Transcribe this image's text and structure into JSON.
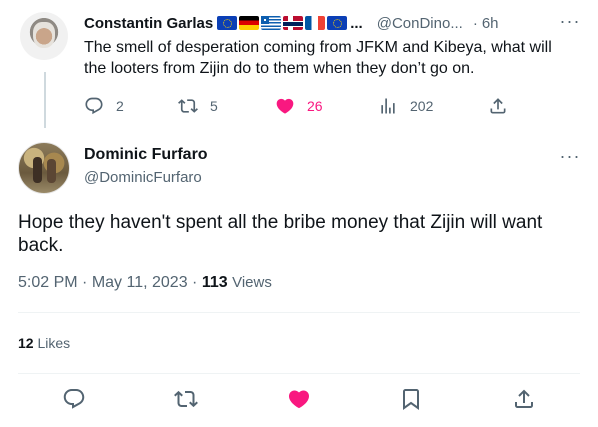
{
  "parent_tweet": {
    "name": "Constantin Garlas",
    "flags_ellipsis": "...",
    "handle": "@ConDino...",
    "time": "6h",
    "more_label": "···",
    "text": "The smell of desperation coming from JFKM and Kibeya, what will the looters from Zijin do to them when they don’t go on.",
    "reply_count": "2",
    "retweet_count": "5",
    "like_count": "26",
    "view_count": "202",
    "like_color": "#f91880"
  },
  "main_tweet": {
    "name": "Dominic Furfaro",
    "handle": "@DominicFurfaro",
    "more_label": "···",
    "text": "Hope they haven't spent all the bribe money that Zijin will want back.",
    "time": "5:02 PM",
    "date": "May 11, 2023",
    "separator": "·",
    "views_count": "113",
    "views_label": "Views",
    "likes_count": "12",
    "likes_label": "Likes",
    "like_color": "#f91880"
  },
  "icons": {
    "reply": "reply-icon",
    "retweet": "retweet-icon",
    "like": "heart-icon",
    "views": "views-icon",
    "share": "share-icon",
    "bookmark": "bookmark-icon"
  }
}
